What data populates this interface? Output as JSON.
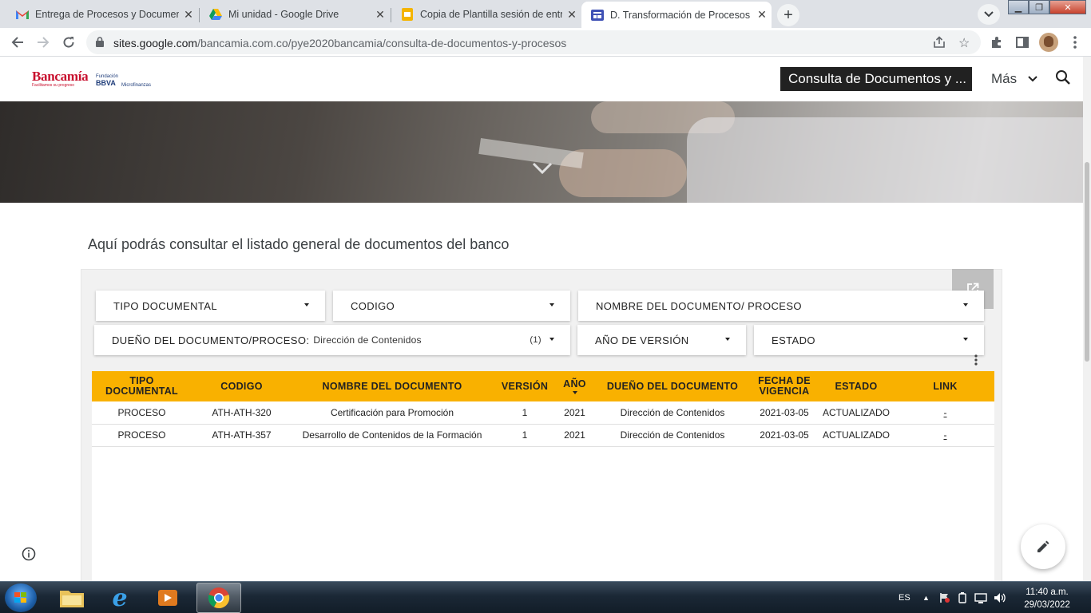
{
  "browser": {
    "tabs": [
      {
        "title": "Entrega de Procesos y Document",
        "icon": "gmail-icon"
      },
      {
        "title": "Mi unidad - Google Drive",
        "icon": "drive-icon"
      },
      {
        "title": "Copia de Plantilla sesión de entre",
        "icon": "slides-icon"
      },
      {
        "title": "D. Transformación de Procesos y",
        "icon": "sites-icon"
      }
    ],
    "active_tab": 3,
    "url_domain": "sites.google.com",
    "url_path": "/bancamia.com.co/pye2020bancamia/consulta-de-documentos-y-procesos"
  },
  "site": {
    "logo_text": "Bancamía",
    "logo_tagline": "Facilitamos su progreso",
    "logo2_line1": "Fundación",
    "logo2_line2": "BBVA",
    "logo2_line3": "Microfinanzas",
    "nav_current": "Consulta de Documentos y ...",
    "nav_more": "Más"
  },
  "content": {
    "intro": "Aquí podrás consultar el listado general de documentos del banco"
  },
  "filters": {
    "tipo": "TIPO DOCUMENTAL",
    "codigo": "CODIGO",
    "nombre": "NOMBRE DEL DOCUMENTO/ PROCESO",
    "dueno_label": "DUEÑO DEL DOCUMENTO/PROCESO:",
    "dueno_value": "Dirección de Contenidos",
    "dueno_count": "(1)",
    "anio": "AÑO DE VERSIÓN",
    "estado": "ESTADO"
  },
  "table": {
    "headers": {
      "tipo_l1": "TIPO",
      "tipo_l2": "DOCUMENTAL",
      "codigo": "CODIGO",
      "nombre": "NOMBRE DEL DOCUMENTO",
      "version": "VERSIÓN",
      "anio": "AÑO",
      "dueno": "DUEÑO DEL DOCUMENTO",
      "fecha_l1": "FECHA DE",
      "fecha_l2": "VIGENCIA",
      "estado": "ESTADO",
      "link": "LINK"
    },
    "rows": [
      {
        "tipo": "PROCESO",
        "codigo": "ATH-ATH-320",
        "nombre": "Certificación para Promoción",
        "version": "1",
        "anio": "2021",
        "dueno": "Dirección de Contenidos",
        "fecha": "2021-03-05",
        "estado": "ACTUALIZADO",
        "link": "-"
      },
      {
        "tipo": "PROCESO",
        "codigo": "ATH-ATH-357",
        "nombre": "Desarrollo de Contenidos de la Formación",
        "version": "1",
        "anio": "2021",
        "dueno": "Dirección de Contenidos",
        "fecha": "2021-03-05",
        "estado": "ACTUALIZADO",
        "link": "-"
      }
    ]
  },
  "taskbar": {
    "language": "ES",
    "time": "11:40 a.m.",
    "date": "29/03/2022"
  },
  "colors": {
    "header_accent": "#f9b100",
    "brand_red": "#c8102e",
    "nav_dark": "#212121"
  }
}
